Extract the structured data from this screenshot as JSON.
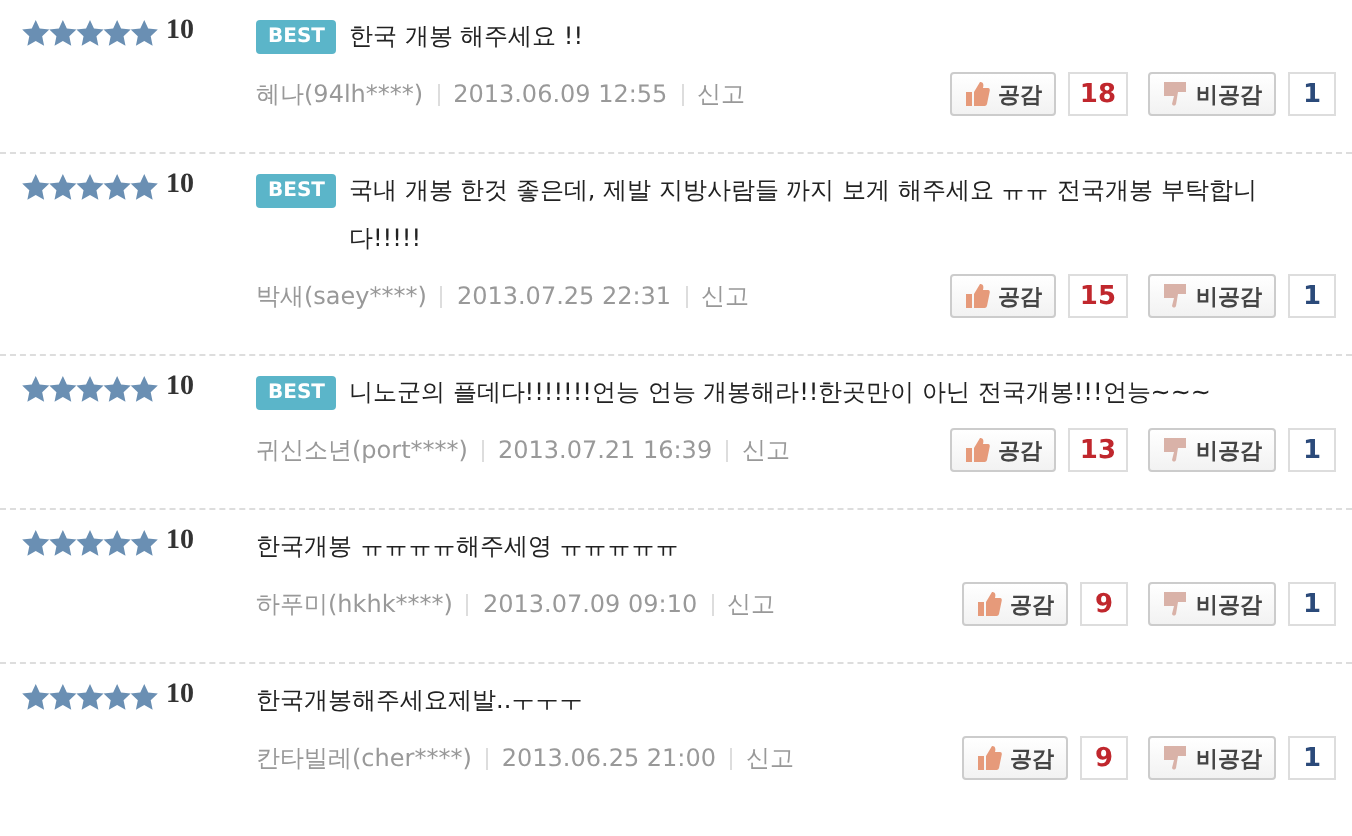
{
  "comments": [
    {
      "stars": 5,
      "score": "10",
      "badge": "BEST",
      "text": "한국 개봉 해주세요 !!",
      "author": "혜나(94lh****)",
      "date": "2013.06.09 12:55",
      "report": "신고",
      "like_label": "공감",
      "like_count": "18",
      "dislike_label": "비공감",
      "dislike_count": "1"
    },
    {
      "stars": 5,
      "score": "10",
      "badge": "BEST",
      "text": "국내 개봉 한것 좋은데, 제발 지방사람들 까지 보게 해주세요 ㅠㅠ 전국개봉 부탁합니다!!!!!",
      "author": "박새(saey****)",
      "date": "2013.07.25 22:31",
      "report": "신고",
      "like_label": "공감",
      "like_count": "15",
      "dislike_label": "비공감",
      "dislike_count": "1"
    },
    {
      "stars": 5,
      "score": "10",
      "badge": "BEST",
      "text": "니노군의 플데다!!!!!!!언능 언능 개봉해라!!한곳만이 아닌 전국개봉!!!언능~~~",
      "author": "귀신소년(port****)",
      "date": "2013.07.21 16:39",
      "report": "신고",
      "like_label": "공감",
      "like_count": "13",
      "dislike_label": "비공감",
      "dislike_count": "1"
    },
    {
      "stars": 5,
      "score": "10",
      "text": "한국개봉 ㅠㅠㅠㅠ해주세영 ㅠㅠㅠㅠㅠ",
      "author": "하푸미(hkhk****)",
      "date": "2013.07.09 09:10",
      "report": "신고",
      "like_label": "공감",
      "like_count": "9",
      "dislike_label": "비공감",
      "dislike_count": "1"
    },
    {
      "stars": 5,
      "score": "10",
      "text": "한국개봉해주세요제발..ㅜㅜㅜ",
      "author": "칸타빌레(cher****)",
      "date": "2013.06.25 21:00",
      "report": "신고",
      "like_label": "공감",
      "like_count": "9",
      "dislike_label": "비공감",
      "dislike_count": "1"
    }
  ]
}
